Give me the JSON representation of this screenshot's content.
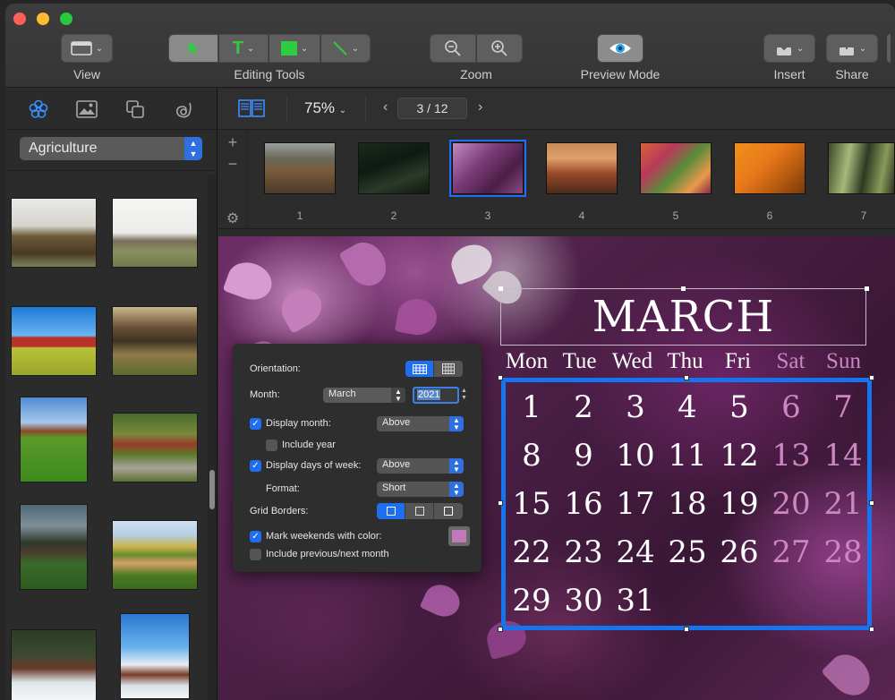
{
  "toolbar": {
    "view": {
      "label": "View"
    },
    "editing_tools": {
      "label": "Editing Tools"
    },
    "zoom": {
      "label": "Zoom"
    },
    "preview": {
      "label": "Preview Mode"
    },
    "insert": {
      "label": "Insert"
    },
    "share": {
      "label": "Share"
    }
  },
  "left_panel": {
    "category": "Agriculture",
    "tabs": [
      "flower-icon",
      "image-icon",
      "shapes-icon",
      "text-icon"
    ]
  },
  "nav": {
    "zoom_value": "75%",
    "page_indicator": "3 / 12"
  },
  "filmstrip": {
    "slides": [
      {
        "number": "1"
      },
      {
        "number": "2"
      },
      {
        "number": "3",
        "selected": true
      },
      {
        "number": "4"
      },
      {
        "number": "5"
      },
      {
        "number": "6"
      },
      {
        "number": "7"
      }
    ]
  },
  "calendar": {
    "month_title": "MARCH",
    "days_of_week": [
      "Mon",
      "Tue",
      "Wed",
      "Thu",
      "Fri",
      "Sat",
      "Sun"
    ],
    "weekend_color": "#cc86c4",
    "weeks": [
      [
        "1",
        "2",
        "3",
        "4",
        "5",
        "6",
        "7"
      ],
      [
        "8",
        "9",
        "10",
        "11",
        "12",
        "13",
        "14"
      ],
      [
        "15",
        "16",
        "17",
        "18",
        "19",
        "20",
        "21"
      ],
      [
        "22",
        "23",
        "24",
        "25",
        "26",
        "27",
        "28"
      ],
      [
        "29",
        "30",
        "31",
        "",
        "",
        "",
        ""
      ]
    ],
    "selection_color": "#1574f0"
  },
  "inspector": {
    "orientation_label": "Orientation:",
    "month_label": "Month:",
    "month_value": "March",
    "year_value": "2021",
    "display_month_label": "Display month:",
    "display_month_value": "Above",
    "include_year_label": "Include year",
    "display_days_label": "Display days of week:",
    "display_days_value": "Above",
    "format_label": "Format:",
    "format_value": "Short",
    "grid_borders_label": "Grid Borders:",
    "mark_weekends_label": "Mark weekends with color:",
    "mark_weekends_color": "#c07ab8",
    "include_prev_next_label": "Include previous/next month"
  }
}
